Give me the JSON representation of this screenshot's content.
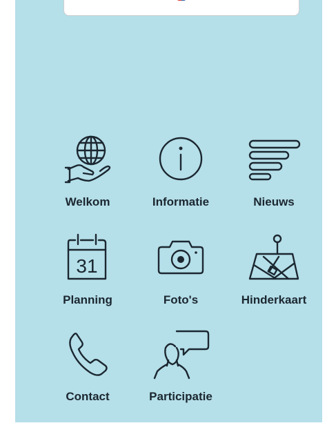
{
  "theme": {
    "background": "#b5dfe9",
    "foreground": "#1b2730"
  },
  "tiles": [
    {
      "label": "Welkom",
      "icon": "globe-hand-icon"
    },
    {
      "label": "Informatie",
      "icon": "info-circle-icon"
    },
    {
      "label": "Nieuws",
      "icon": "news-lines-icon"
    },
    {
      "label": "Planning",
      "icon": "calendar-icon",
      "icon_text": "31"
    },
    {
      "label": "Foto's",
      "icon": "camera-icon"
    },
    {
      "label": "Hinderkaart",
      "icon": "map-pin-icon"
    },
    {
      "label": "Contact",
      "icon": "phone-icon"
    },
    {
      "label": "Participatie",
      "icon": "speech-person-icon"
    }
  ]
}
